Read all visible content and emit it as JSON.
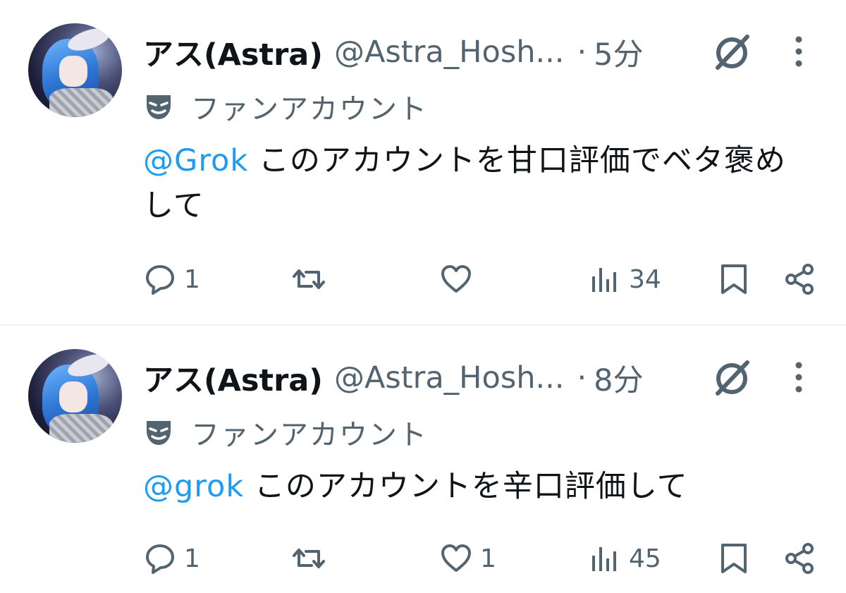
{
  "tweets": [
    {
      "name": "アス(Astra)",
      "handle": "@Astra_Hosh...",
      "separator": "·",
      "time": "5分",
      "label": "ファンアカウント",
      "mention": "@Grok",
      "text": " このアカウントを甘口評価でベタ褒めして",
      "reply_count": "1",
      "retweet_count": "",
      "like_count": "",
      "view_count": "34"
    },
    {
      "name": "アス(Astra)",
      "handle": "@Astra_Hosh...",
      "separator": "·",
      "time": "8分",
      "label": "ファンアカウント",
      "mention": "@grok",
      "text": " このアカウントを辛口評価して",
      "reply_count": "1",
      "retweet_count": "",
      "like_count": "1",
      "view_count": "45"
    }
  ],
  "icons": {
    "reply": "reply-icon",
    "retweet": "retweet-icon",
    "like": "heart-icon",
    "views": "views-icon",
    "bookmark": "bookmark-icon",
    "share": "share-icon",
    "grok": "grok-icon",
    "more": "more-icon",
    "label": "theater-mask-icon"
  },
  "colors": {
    "text": "#0f1419",
    "muted": "#536471",
    "accent": "#1d9bf0",
    "divider": "#eff3f4"
  }
}
